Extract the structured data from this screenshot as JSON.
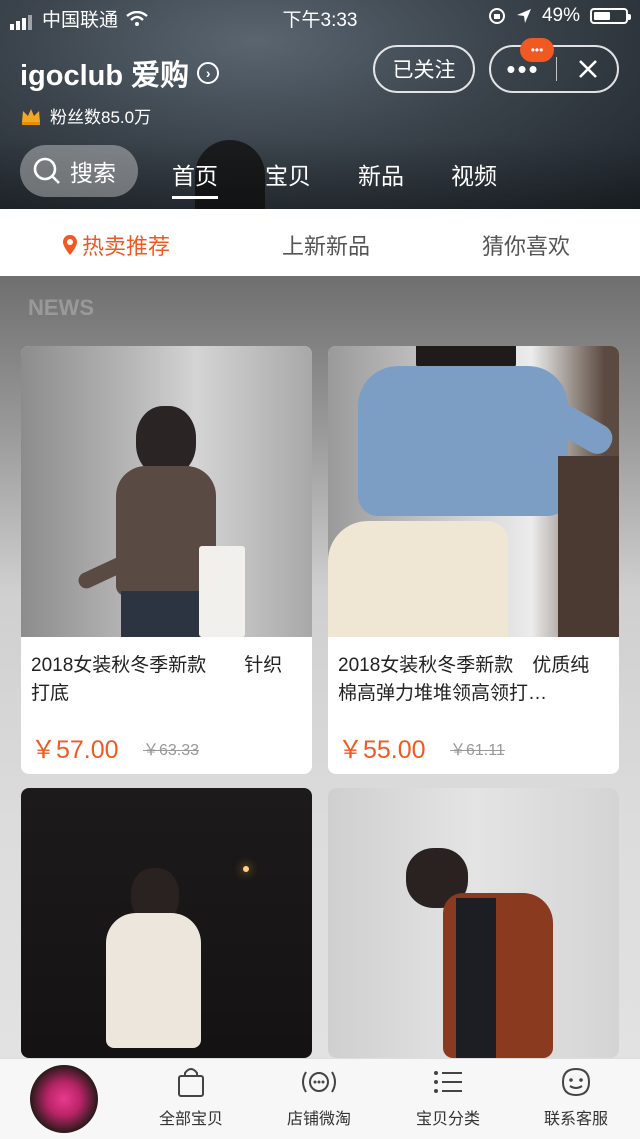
{
  "status_bar": {
    "carrier": "中国联通",
    "time": "下午3:33",
    "battery": "49%"
  },
  "store": {
    "name": "igoclub 爱购",
    "fans": "粉丝数85.0万",
    "follow_label": "已关注",
    "badge": "•••"
  },
  "nav": {
    "search_label": "搜索",
    "tabs": [
      "首页",
      "宝贝",
      "新品",
      "视频"
    ]
  },
  "subtabs": [
    "热卖推荐",
    "上新新品",
    "猜你喜欢"
  ],
  "banner_text": "NEWS",
  "products": [
    {
      "name": "2018女装秋冬季新款　　针织打底",
      "price": "￥57.00",
      "old_price": "￥63.33"
    },
    {
      "name": "2018女装秋冬季新款　优质纯棉高弹力堆堆领高领打…",
      "price": "￥55.00",
      "old_price": "￥61.11"
    },
    {
      "name": "",
      "price": "",
      "old_price": ""
    },
    {
      "name": "",
      "price": "",
      "old_price": ""
    }
  ],
  "bottom_bar": {
    "items": [
      "全部宝贝",
      "店铺微淘",
      "宝贝分类",
      "联系客服"
    ]
  },
  "colors": {
    "accent": "#f05a22"
  }
}
